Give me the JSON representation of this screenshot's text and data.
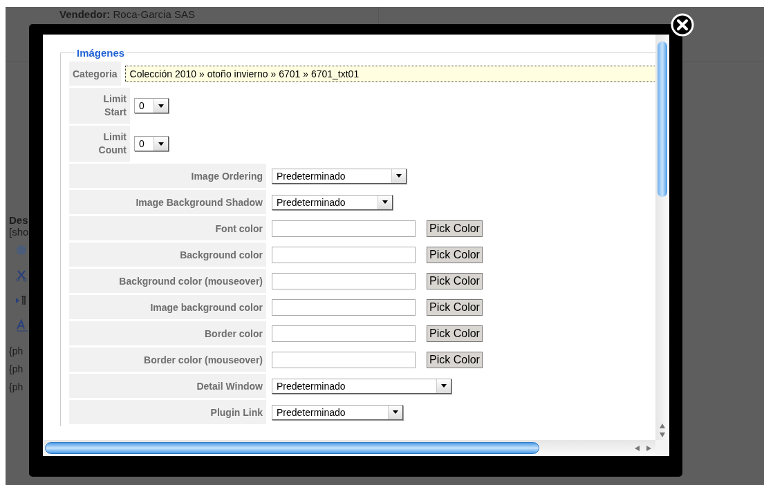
{
  "background_page": {
    "vendor_label": "Vendedor:",
    "vendor": "Roca-Garcia SAS",
    "description_label": "Des",
    "show_link": "[sho",
    "placeholders": [
      "{ph",
      "{ph",
      "{ph"
    ]
  },
  "dialog": {
    "legend": "Imágenes",
    "category": {
      "label": "Categoria",
      "value": "Colección 2010 » otoño invierno » 6701 » 6701_txt01"
    },
    "limits": [
      {
        "label": "Limit Start",
        "value": "0"
      },
      {
        "label": "Limit Count",
        "value": "0"
      }
    ],
    "rows": [
      {
        "kind": "select",
        "label": "Image Ordering",
        "value": "Predeterminado"
      },
      {
        "kind": "select",
        "label": "Image Background Shadow",
        "value": "Predeterminado"
      },
      {
        "kind": "color",
        "label": "Font color",
        "button": "Pick Color"
      },
      {
        "kind": "color",
        "label": "Background color",
        "button": "Pick Color"
      },
      {
        "kind": "color",
        "label": "Background color (mouseover)",
        "button": "Pick Color"
      },
      {
        "kind": "color",
        "label": "Image background color",
        "button": "Pick Color"
      },
      {
        "kind": "color",
        "label": "Border color",
        "button": "Pick Color"
      },
      {
        "kind": "color",
        "label": "Border color (mouseover)",
        "button": "Pick Color"
      },
      {
        "kind": "select",
        "label": "Detail Window",
        "value": "Predeterminado"
      },
      {
        "kind": "select",
        "label": "Plugin Link",
        "value": "Predeterminado"
      }
    ]
  }
}
